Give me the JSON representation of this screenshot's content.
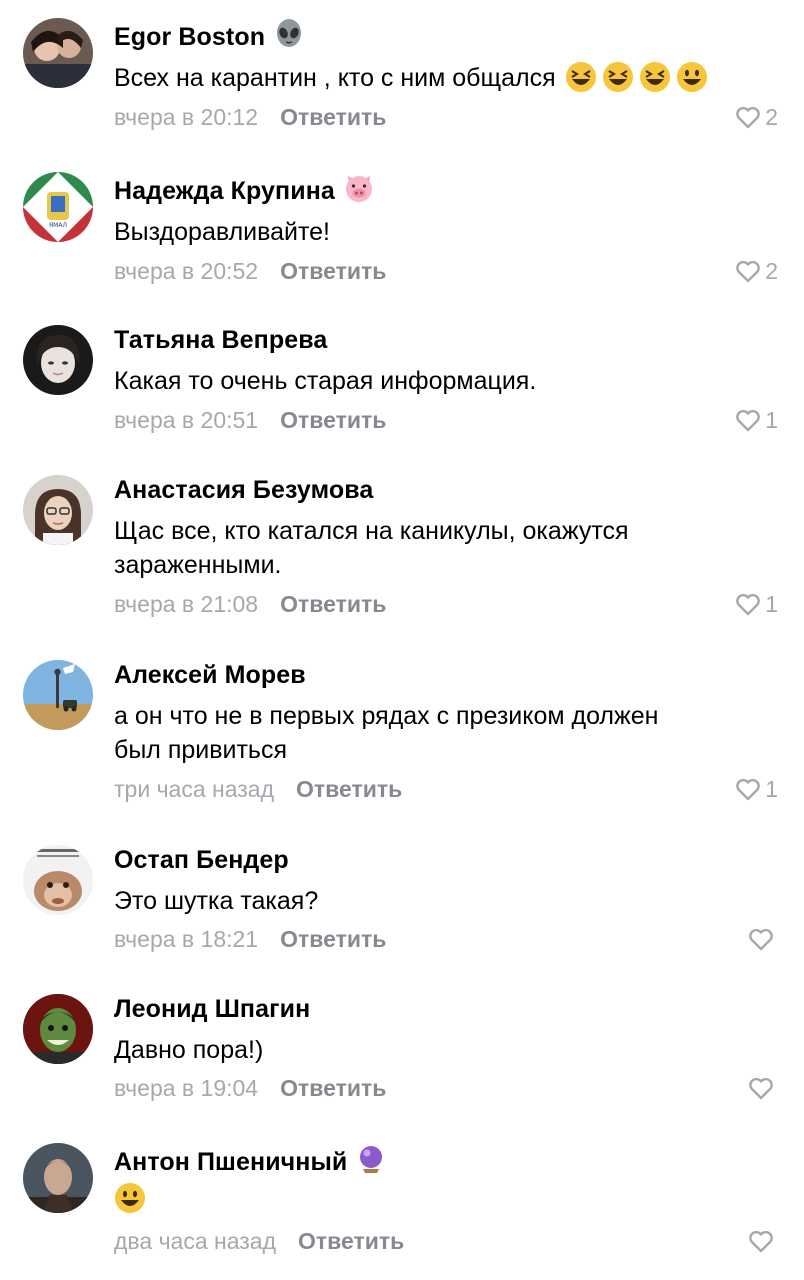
{
  "comments": [
    {
      "name": "Egor Boston",
      "text": "Всех на карантин , кто с ним общался",
      "time": "вчера в 20:12",
      "reply": "Ответить",
      "likes": "2",
      "badge": "alien-emoji",
      "emojis": [
        "grinning-squinting-emoji",
        "grinning-squinting-emoji",
        "grinning-squinting-emoji",
        "grinning-emoji"
      ]
    },
    {
      "name": "Надежда Крупина",
      "text": "Выздоравливайте!",
      "time": "вчера в 20:52",
      "reply": "Ответить",
      "likes": "2",
      "badge": "pig-face-emoji"
    },
    {
      "name": "Татьяна Вепрева",
      "text": "Какая то очень старая информация.",
      "time": "вчера в 20:51",
      "reply": "Ответить",
      "likes": "1"
    },
    {
      "name": "Анастасия Безумова",
      "text_lines": [
        "Щас все, кто катался на каникулы, окажутся",
        "зараженными."
      ],
      "time": "вчера в 21:08",
      "reply": "Ответить",
      "likes": "1"
    },
    {
      "name": "Алексей Морев",
      "text_lines": [
        "а он что не в первых рядах с презиком должен",
        "был привиться"
      ],
      "time": "три часа назад",
      "reply": "Ответить",
      "likes": "1"
    },
    {
      "name": "Остап Бендер",
      "text": "Это шутка такая?",
      "time": "вчера в 18:21",
      "reply": "Ответить",
      "likes": ""
    },
    {
      "name": "Леонид Шпагин",
      "text": "Давно пора!)",
      "time": "вчера в 19:04",
      "reply": "Ответить",
      "likes": ""
    },
    {
      "name": "Антон Пшеничный",
      "text": "",
      "time": "два часа назад",
      "reply": "Ответить",
      "likes": "",
      "badge": "crystal-ball-emoji",
      "emojis": [
        "grinning-emoji"
      ]
    }
  ],
  "colors": {
    "meta": "#a5a8ac",
    "reply": "#868a90",
    "emoji": "#f6c53a"
  }
}
